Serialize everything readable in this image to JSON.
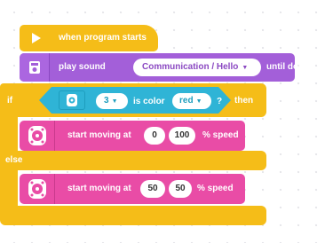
{
  "hat_block": {
    "label": "when program starts",
    "icon": "play-icon"
  },
  "sound_block": {
    "label": "play sound",
    "sound": "Communication / Hello",
    "mode": "until done",
    "icon": "speaker-icon",
    "color": "#a35fd9"
  },
  "if_block": {
    "if_label": "if",
    "then_label": "then",
    "else_label": "else",
    "color": "#f5bd18",
    "condition": {
      "icon": "color-sensor-icon",
      "port": "3",
      "text": "is color",
      "value": "red",
      "question": "?"
    }
  },
  "move_blocks": [
    {
      "label": "start moving at",
      "left_speed": "0",
      "right_speed": "100",
      "unit": "% speed",
      "icon": "tank-wheels-icon"
    },
    {
      "label": "start moving at",
      "left_speed": "50",
      "right_speed": "50",
      "unit": "% speed",
      "icon": "tank-wheels-icon"
    }
  ],
  "colors": {
    "motor": "#e94ca6",
    "sensor": "#2fb4d6",
    "sound": "#a35fd9",
    "event": "#f5bd18"
  }
}
